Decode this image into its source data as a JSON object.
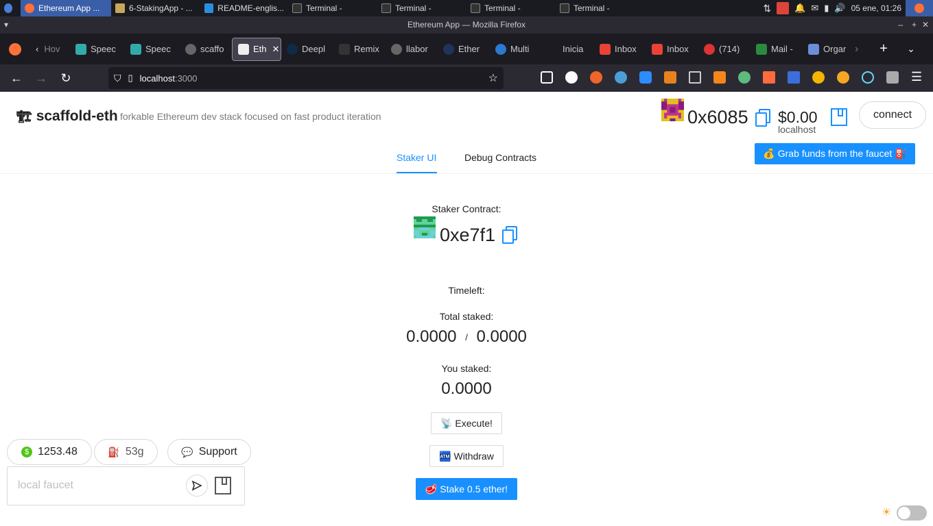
{
  "system_bar": {
    "tasks": [
      {
        "label": "Ethereum App ...",
        "active": true
      },
      {
        "label": "6-StakingApp - ..."
      },
      {
        "label": "README-englis..."
      },
      {
        "label": "Terminal -"
      },
      {
        "label": "Terminal -"
      },
      {
        "label": "Terminal -"
      },
      {
        "label": "Terminal -"
      }
    ],
    "clock": "05 ene, 01:26"
  },
  "window_title": "Ethereum App — Mozilla Firefox",
  "browser_tabs": [
    {
      "label": "Hov"
    },
    {
      "label": "Speec"
    },
    {
      "label": "Speec"
    },
    {
      "label": "scaffo"
    },
    {
      "label": "Eth",
      "active": true
    },
    {
      "label": "Deepl"
    },
    {
      "label": "Remix"
    },
    {
      "label": "llabor"
    },
    {
      "label": "Ether"
    },
    {
      "label": "Multi"
    },
    {
      "label": "Inicia"
    },
    {
      "label": "Inbox"
    },
    {
      "label": "Inbox"
    },
    {
      "label": "(714)"
    },
    {
      "label": "Mail -"
    },
    {
      "label": "Orgar"
    }
  ],
  "url": {
    "host": "localhost",
    "port": ":3000"
  },
  "header": {
    "brand_icon": "🏗",
    "brand": "scaffold-eth",
    "subtitle": "forkable Ethereum dev stack focused on fast product iteration",
    "account_address": "0x6085",
    "balance": "$0.00",
    "network": "localhost",
    "connect_label": "connect"
  },
  "menu": {
    "staker_ui": "Staker UI",
    "debug_contracts": "Debug Contracts"
  },
  "faucet_button": "💰 Grab funds from the faucet ⛽️",
  "staker": {
    "contract_label": "Staker Contract:",
    "contract_address": "0xe7f1",
    "timeleft_label": "Timeleft:",
    "total_staked_label": "Total staked:",
    "total_staked": "0.0000",
    "separator": "/",
    "threshold": "0.0000",
    "you_staked_label": "You staked:",
    "you_staked": "0.0000",
    "execute_label": "📡 Execute!",
    "withdraw_label": "🏧 Withdraw",
    "stake_label": "🥩 Stake 0.5 ether!"
  },
  "footer": {
    "price": "1253.48",
    "gas": "53g",
    "support": "Support",
    "faucet_placeholder": "local faucet"
  },
  "colors": {
    "accent": "#1890ff",
    "taskbar_active": "#3a5ea8",
    "firefox_dark": "#2b2a33"
  }
}
